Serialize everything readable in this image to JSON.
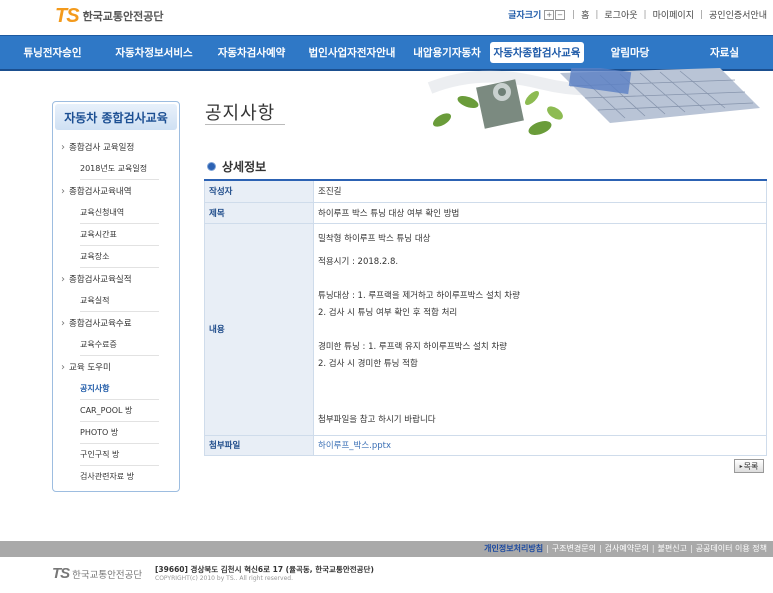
{
  "header": {
    "logo_mark": "TS",
    "logo_name": "한국교통안전공단",
    "font_size_label": "글자크기",
    "font_plus": "+",
    "font_minus": "−",
    "links": [
      "홈",
      "로그아웃",
      "마이페이지",
      "공인인증서안내"
    ]
  },
  "nav": {
    "items": [
      "튜닝전자승인",
      "자동차정보서비스",
      "자동차검사예약",
      "법인사업자전자안내",
      "내압용기자동차",
      "자동차종합검사교육",
      "알림마당",
      "자료실"
    ],
    "active_index": 5
  },
  "sidebar": {
    "title": "자동차 종합검사교육",
    "groups": [
      {
        "label": "종합검사 교육일정",
        "subs": [
          "2018년도 교육일정"
        ]
      },
      {
        "label": "종합검사교육내역",
        "subs": [
          "교육신청내역",
          "교육시간표",
          "교육장소"
        ]
      },
      {
        "label": "종합검사교육실적",
        "subs": [
          "교육실적"
        ]
      },
      {
        "label": "종합검사교육수료",
        "subs": [
          "교육수료증"
        ]
      },
      {
        "label": "교육 도우미",
        "subs": [
          "공지사항",
          "CAR_POOL 방",
          "PHOTO 방",
          "구인구직 방",
          "검사관련자료 방"
        ]
      }
    ],
    "active_sub": "공지사항"
  },
  "page": {
    "title": "공지사항",
    "section": "상세정보"
  },
  "detail": {
    "author_label": "작성자",
    "author": "조진길",
    "subject_label": "제목",
    "subject": "하이루프 박스 튜닝 대상 여부 확인 방법",
    "content_label": "내용",
    "content_lines": [
      "밀착형 하이루프 박스 튜닝 대상",
      "",
      "적용시기 : 2018.2.8.",
      "",
      "튜닝대상 : 1. 루프랙을 제거하고 하이루프박스 설치 차량",
      "2. 검사 시 튜닝 여부 확인 후 적합 처리",
      "",
      "경미한 튜닝 : 1. 루프랙 유지 하이루프박스 설치 차량",
      "2. 검사 시 경미한 튜닝 적합",
      "",
      "",
      "",
      "첨부파일을 참고 하시기 바랍니다"
    ],
    "attach_label": "첨부파일",
    "attach_file": "하이루프_박스.pptx"
  },
  "list_button": "목록",
  "footer": {
    "links": [
      "개인정보처리방침",
      "구조변경문의",
      "검사예약문의",
      "불편신고",
      "공공데이터 이용 정책"
    ],
    "logo_mark": "TS",
    "logo_name": "한국교통안전공단",
    "address": "[39660] 경상북도 김천시 혁신6로 17 (율곡동, 한국교통안전공단)",
    "copyright": "COPYRIGHT(c) 2010 by TS.. All right reserved."
  },
  "colors": {
    "nav": "#2f78c6",
    "accent": "#1e5aa8",
    "logo_orange": "#f39a1c"
  }
}
